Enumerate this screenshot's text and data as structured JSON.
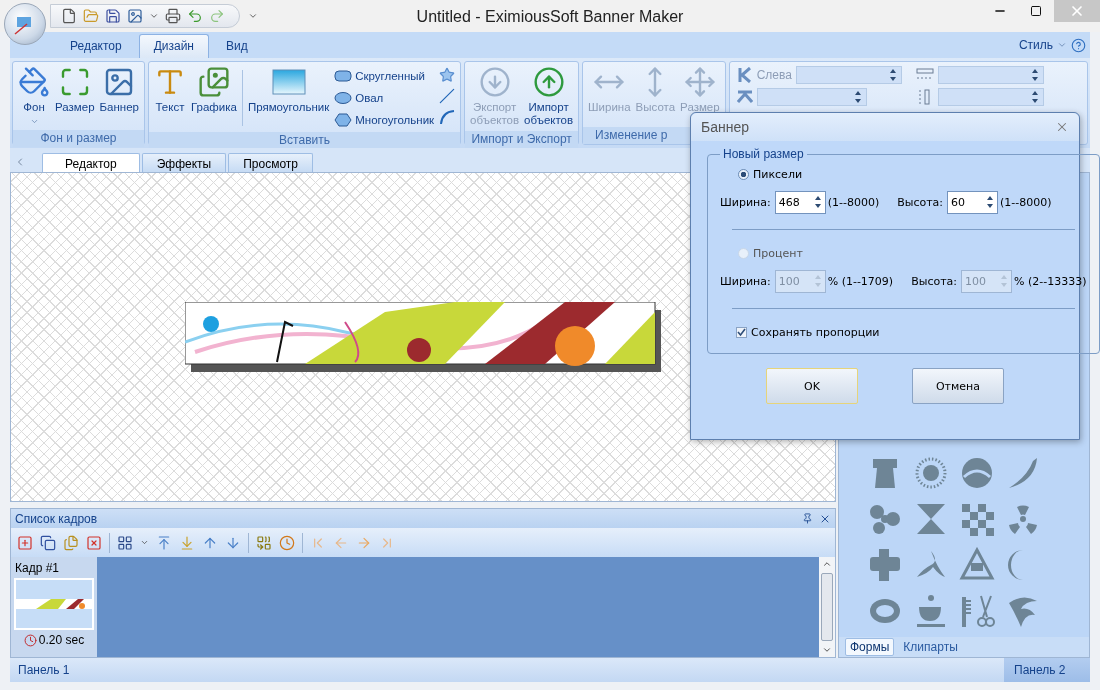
{
  "window": {
    "title": "Untitled - EximiousSoft Banner Maker"
  },
  "ribbon": {
    "tabs": [
      {
        "label": "Редактор",
        "selected": false
      },
      {
        "label": "Дизайн",
        "selected": true
      },
      {
        "label": "Вид",
        "selected": false
      }
    ],
    "style_label": "Стиль",
    "groups": [
      {
        "kind": "buttons",
        "label": "Фон и размер",
        "large_buttons": [
          {
            "label": "Фон",
            "disabled": false,
            "dropdown": true
          },
          {
            "label": "Размер",
            "disabled": false,
            "dropdown": false
          },
          {
            "label": "Баннер",
            "disabled": false,
            "dropdown": false
          }
        ]
      },
      {
        "kind": "insert",
        "label": "Вставить",
        "large_buttons": [
          {
            "label": "Текст",
            "disabled": false,
            "dropdown": false
          },
          {
            "label": "Графика",
            "disabled": false,
            "dropdown": false
          },
          {
            "label": "Прямоугольник",
            "disabled": false,
            "dropdown": false
          }
        ],
        "small_buttons": [
          {
            "label": "Скругленный"
          },
          {
            "label": "Овал"
          },
          {
            "label": "Многоугольник"
          }
        ]
      },
      {
        "kind": "buttons",
        "label": "Импорт и Экспорт",
        "large_buttons": [
          {
            "label": "Экспорт объектов",
            "disabled": true,
            "dropdown": false
          },
          {
            "label": "Импорт объектов",
            "disabled": false,
            "dropdown": false
          }
        ]
      },
      {
        "kind": "buttons",
        "label": "Изменение р",
        "large_buttons": [
          {
            "label": "Ширина",
            "disabled": true,
            "dropdown": false
          },
          {
            "label": "Высота",
            "disabled": true,
            "dropdown": false
          },
          {
            "label": "Размер",
            "disabled": true,
            "dropdown": false
          }
        ]
      },
      {
        "kind": "position",
        "field_label": "Слева"
      }
    ]
  },
  "doc_tabs": [
    {
      "label": "Редактор",
      "selected": true
    },
    {
      "label": "Эффекты",
      "selected": false
    },
    {
      "label": "Просмотр",
      "selected": false
    }
  ],
  "frames_panel": {
    "title": "Список кадров",
    "frames": [
      {
        "label": "Кадр #1",
        "duration": "0.20 sec",
        "selected": true
      }
    ]
  },
  "side_panel": {
    "tabs": [
      {
        "label": "Формы",
        "selected": true
      },
      {
        "label": "Клипарты",
        "selected": false
      }
    ]
  },
  "status_bar": {
    "left": "Панель 1",
    "right": "Панель 2"
  },
  "dialog": {
    "title": "Баннер",
    "group_title": "Новый размер",
    "options": [
      {
        "label": "Пиксели",
        "selected": true,
        "fields": [
          {
            "label": "Ширина:",
            "value": "468",
            "range": "(1--8000)",
            "disabled": false
          },
          {
            "label": "Высота:",
            "value": "60",
            "range": "(1--8000)",
            "disabled": false
          }
        ]
      },
      {
        "label": "Процент",
        "selected": false,
        "fields": [
          {
            "label": "Ширина:",
            "value": "100",
            "range": "% (1--1709)",
            "disabled": true
          },
          {
            "label": "Высота:",
            "value": "100",
            "range": "% (2--13333)",
            "disabled": true
          }
        ]
      }
    ],
    "keep_ratio": {
      "label": "Сохранять пропорции",
      "checked": true
    },
    "buttons": [
      {
        "label": "OK",
        "default": true
      },
      {
        "label": "Отмена",
        "default": false
      }
    ]
  }
}
